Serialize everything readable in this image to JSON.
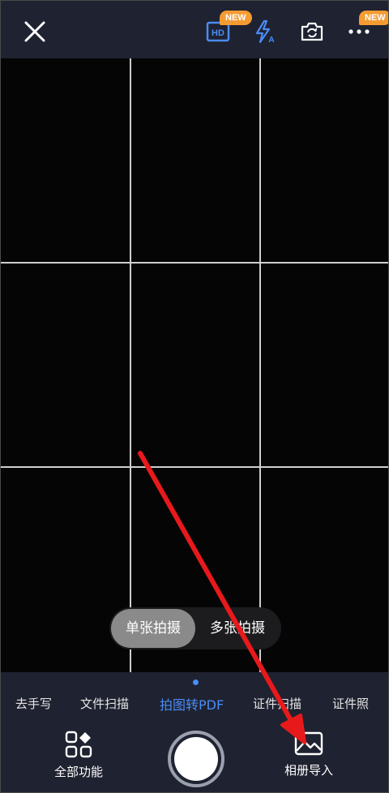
{
  "toolbar": {
    "close_icon": "close-icon",
    "hd_label": "HD",
    "hd_badge": "NEW",
    "flash_icon": "flash-auto-icon",
    "flip_icon": "switch-camera-icon",
    "more_badge": "NEW",
    "more_icon": "more-icon"
  },
  "mode_toggle": {
    "single": "单张拍摄",
    "multi": "多张拍摄",
    "selected": "single"
  },
  "tabs": [
    {
      "label": "去手写"
    },
    {
      "label": "文件扫描"
    },
    {
      "label": "拍图转PDF",
      "active": true
    },
    {
      "label": "证件扫描"
    },
    {
      "label": "证件照"
    }
  ],
  "actions": {
    "all_features": "全部功能",
    "album_import": "相册导入"
  },
  "colors": {
    "accent": "#4a8cf7",
    "badge": "#f59b32",
    "arrow": "#e8191b",
    "panel": "#1f2230"
  }
}
